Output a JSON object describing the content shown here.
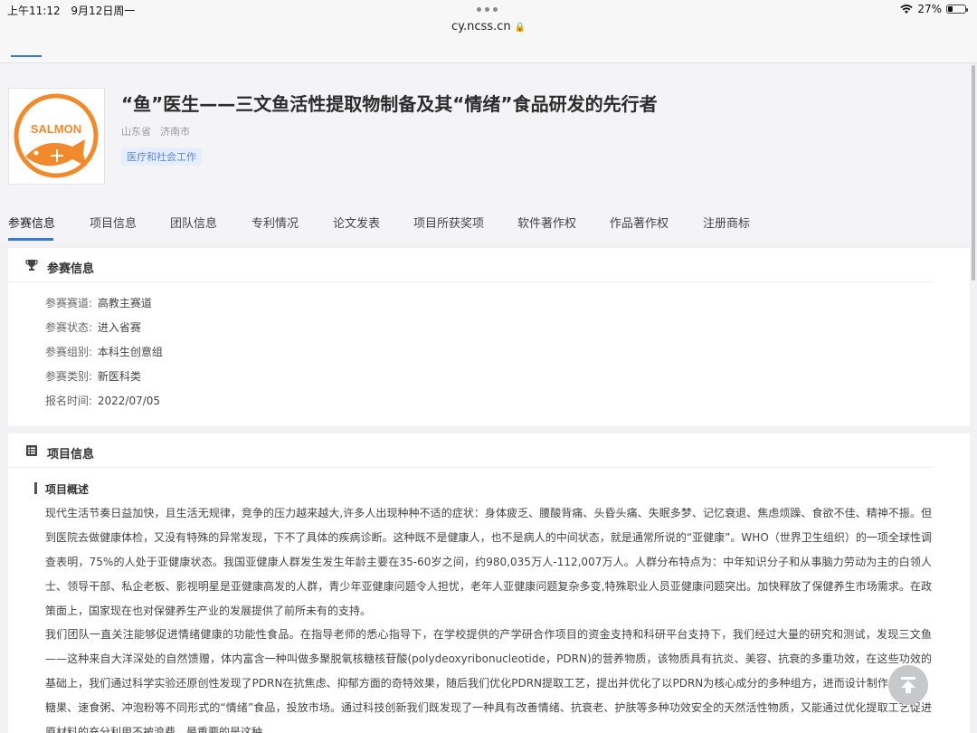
{
  "status_bar": {
    "time": "上午11:12",
    "date": "9月12日周一",
    "battery_percent": "27%",
    "battery_level": 0.27
  },
  "browser": {
    "url": "cy.ncss.cn"
  },
  "project": {
    "logo_text": "SALMON",
    "title": "“鱼”医生——三文鱼活性提取物制备及其“情绪”食品研发的先行者",
    "province": "山东省",
    "city": "济南市",
    "tag": "医疗和社会工作"
  },
  "tabs": [
    {
      "label": "参赛信息",
      "active": true
    },
    {
      "label": "项目信息"
    },
    {
      "label": "团队信息"
    },
    {
      "label": "专利情况"
    },
    {
      "label": "论文发表"
    },
    {
      "label": "项目所获奖项"
    },
    {
      "label": "软件著作权"
    },
    {
      "label": "作品著作权"
    },
    {
      "label": "注册商标"
    }
  ],
  "competition": {
    "section_title": "参赛信息",
    "rows": [
      {
        "key": "参赛赛道:",
        "value": "高教主赛道"
      },
      {
        "key": "参赛状态:",
        "value": "进入省赛"
      },
      {
        "key": "参赛组别:",
        "value": "本科生创意组"
      },
      {
        "key": "参赛类别:",
        "value": "新医科类"
      },
      {
        "key": "报名时间:",
        "value": "2022/07/05"
      }
    ]
  },
  "project_info": {
    "section_title": "项目信息",
    "sub_title": "项目概述",
    "paragraph1": "现代生活节奏日益加快，且生活无规律，竞争的压力越来越大,许多人出现种种不适的症状：身体疲乏、腰酸背痛、头昏头痛、失眠多梦、记忆衰退、焦虑烦躁、食欲不佳、精神不振。但到医院去做健康体检，又没有特殊的异常发现，下不了具体的疾病诊断。这种既不是健康人，也不是病人的中间状态，就是通常所说的“亚健康”。WHO（世界卫生组织）的一项全球性调查表明，75%的人处于亚健康状态。我国亚健康人群发生发生年龄主要在35-60岁之间，约980,035万人-112,007万人。人群分布特点为：中年知识分子和从事脑力劳动为主的白领人士、领导干部、私企老板、影视明星是亚健康高发的人群，青少年亚健康问题令人担忧，老年人亚健康问题复杂多变,特殊职业人员亚健康问题突出。加快释放了保健养生市场需求。在政策面上，国家现在也对保健养生产业的发展提供了前所未有的支持。",
    "paragraph2": "我们团队一直关注能够促进情绪健康的功能性食品。在指导老师的悉心指导下，在学校提供的产学研合作项目的资金支持和科研平台支持下，我们经过大量的研究和测试，发现三文鱼——这种来自大洋深处的自然馈赠，体内富含一种叫做多聚脱氧核糖核苷酸(polydeoxyribonucleotide，PDRN)的营养物质，该物质具有抗炎、美容、抗衰的多重功效，在这些功效的基础上，我们通过科学实验还原创性发现了PDRN在抗焦虑、抑郁方面的奇特效果，随后我们优化PDRN提取工艺，提出并优化了以PDRN为核心成分的多种组方，进而设计制作成饮料、糖果、速食粥、冲泡粉等不同形式的“情绪”食品，投放市场。通过科技创新我们既发现了一种具有改善情绪、抗衰老、护肤等多种功效安全的天然活性物质，又能通过优化提取工艺促进原材料的充分利用不被浪费，最重要的是这种"
  }
}
